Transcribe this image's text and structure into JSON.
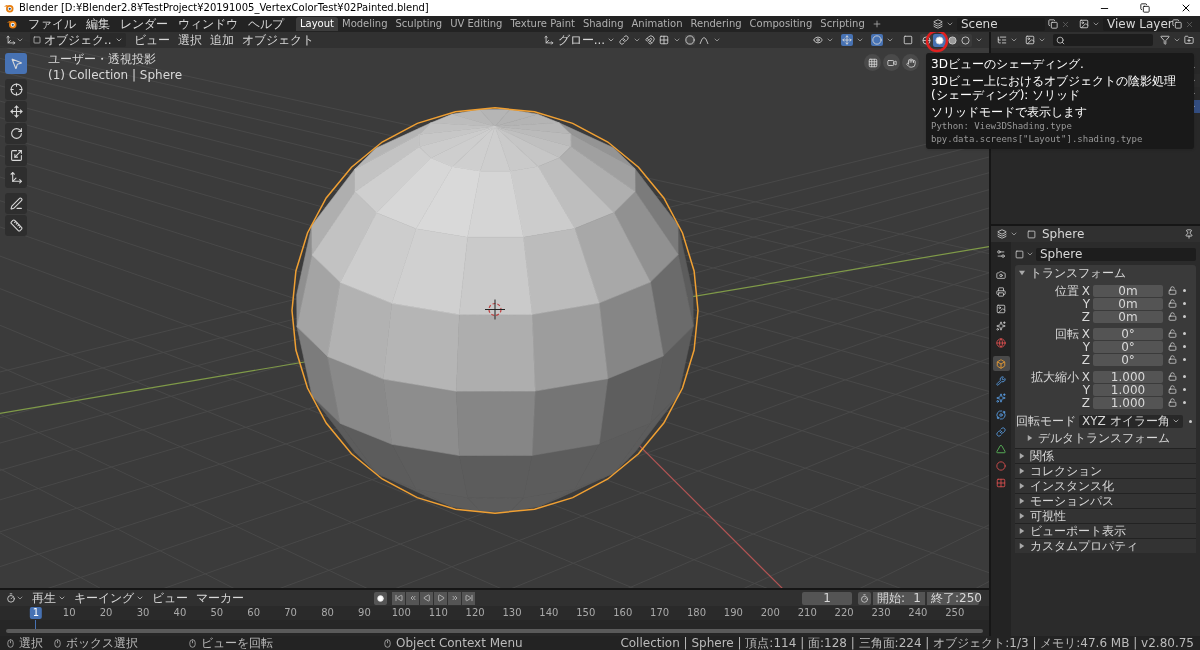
{
  "window": {
    "title": "Blender [D:¥Blender2.8¥TestProject¥20191005_VertexColorTest¥02Painted.blend]"
  },
  "menu": [
    "ファイル",
    "編集",
    "レンダー",
    "ウィンドウ",
    "ヘルプ"
  ],
  "workspaces": [
    {
      "label": "Layout",
      "selected": true
    },
    {
      "label": "Modeling",
      "selected": false
    },
    {
      "label": "Sculpting",
      "selected": false
    },
    {
      "label": "UV Editing",
      "selected": false
    },
    {
      "label": "Texture Paint",
      "selected": false
    },
    {
      "label": "Shading",
      "selected": false
    },
    {
      "label": "Animation",
      "selected": false
    },
    {
      "label": "Rendering",
      "selected": false
    },
    {
      "label": "Compositing",
      "selected": false
    },
    {
      "label": "Scripting",
      "selected": false
    }
  ],
  "scene": "Scene",
  "view_layer": "View Layer",
  "viewport": {
    "mode": "オブジェク..",
    "menus": [
      "ビュー",
      "選択",
      "追加",
      "オブジェクト"
    ],
    "orientation": "グロー...",
    "view_name": "ユーザー・透視投影",
    "collection_label": "(1) Collection | Sphere",
    "tools": [
      {
        "selected": true
      },
      {
        "selected": false
      },
      {
        "selected": false
      },
      {
        "selected": false
      },
      {
        "selected": false
      },
      {
        "selected": false
      },
      {
        "selected": false
      },
      {
        "selected": false
      }
    ],
    "shading_modes": [
      {
        "selected": false
      },
      {
        "selected": true
      },
      {
        "selected": false
      },
      {
        "selected": false
      }
    ]
  },
  "tooltip": {
    "title": "3Dビューのシェーディング.",
    "description": "3Dビュー上におけるオブジェクトの陰影処理(シェーディング): ソリッド",
    "detail": "ソリッドモードで表示します",
    "python": [
      "Python: View3DShading.type",
      "bpy.data.screens[\"Layout\"].shading.type"
    ]
  },
  "outliner": {
    "rows": [
      {
        "selected": false
      },
      {
        "selected": false
      },
      {
        "selected": false
      },
      {
        "selected": true
      }
    ]
  },
  "properties": {
    "object_name": "Sphere",
    "data_name": "Sphere",
    "tabs": [
      {
        "selected": false
      },
      {
        "selected": false
      },
      {
        "selected": false
      },
      {
        "selected": false
      },
      {
        "selected": false
      },
      {
        "selected": false
      },
      {
        "selected": true
      },
      {
        "selected": false
      },
      {
        "selected": false
      },
      {
        "selected": false
      },
      {
        "selected": false
      },
      {
        "selected": false
      },
      {
        "selected": false
      },
      {
        "selected": false
      }
    ],
    "transform": {
      "title": "トランスフォーム",
      "expanded": true,
      "groups": [
        {
          "label": "位置",
          "axes": [
            {
              "axis": "X",
              "value": "0m"
            },
            {
              "axis": "Y",
              "value": "0m"
            },
            {
              "axis": "Z",
              "value": "0m"
            }
          ]
        },
        {
          "label": "回転",
          "axes": [
            {
              "axis": "X",
              "value": "0°"
            },
            {
              "axis": "Y",
              "value": "0°"
            },
            {
              "axis": "Z",
              "value": "0°"
            }
          ]
        },
        {
          "label": "拡大縮小",
          "axes": [
            {
              "axis": "X",
              "value": "1.000"
            },
            {
              "axis": "Y",
              "value": "1.000"
            },
            {
              "axis": "Z",
              "value": "1.000"
            }
          ]
        }
      ],
      "rotation_mode_label": "回転モード",
      "rotation_mode": "XYZ オイラー角",
      "subpanels": [
        {
          "label": "デルタトランスフォーム",
          "expanded": false
        }
      ]
    },
    "panels": [
      {
        "label": "関係",
        "expanded": false
      },
      {
        "label": "コレクション",
        "expanded": false
      },
      {
        "label": "インスタンス化",
        "expanded": false
      },
      {
        "label": "モーションパス",
        "expanded": false
      },
      {
        "label": "可視性",
        "expanded": false
      },
      {
        "label": "ビューポート表示",
        "expanded": false
      },
      {
        "label": "カスタムプロパティ",
        "expanded": false
      }
    ]
  },
  "timeline": {
    "menus": [
      {
        "label": "再生",
        "dropdown": true
      },
      {
        "label": "キーイング",
        "dropdown": true
      },
      {
        "label": "ビュー",
        "dropdown": false
      },
      {
        "label": "マーカー",
        "dropdown": false
      }
    ],
    "current_frame": "1",
    "start_label": "開始:",
    "start": "1",
    "end_label": "終了:",
    "end": "250",
    "ticks": [
      {
        "label": "1",
        "selected": true
      },
      {
        "label": "10",
        "selected": false
      },
      {
        "label": "20",
        "selected": false
      },
      {
        "label": "30",
        "selected": false
      },
      {
        "label": "40",
        "selected": false
      },
      {
        "label": "50",
        "selected": false
      },
      {
        "label": "60",
        "selected": false
      },
      {
        "label": "70",
        "selected": false
      },
      {
        "label": "80",
        "selected": false
      },
      {
        "label": "90",
        "selected": false
      },
      {
        "label": "100",
        "selected": false
      },
      {
        "label": "110",
        "selected": false
      },
      {
        "label": "120",
        "selected": false
      },
      {
        "label": "130",
        "selected": false
      },
      {
        "label": "140",
        "selected": false
      },
      {
        "label": "150",
        "selected": false
      },
      {
        "label": "160",
        "selected": false
      },
      {
        "label": "170",
        "selected": false
      },
      {
        "label": "180",
        "selected": false
      },
      {
        "label": "190",
        "selected": false
      },
      {
        "label": "200",
        "selected": false
      },
      {
        "label": "210",
        "selected": false
      },
      {
        "label": "220",
        "selected": false
      },
      {
        "label": "230",
        "selected": false
      },
      {
        "label": "240",
        "selected": false
      },
      {
        "label": "250",
        "selected": false
      }
    ]
  },
  "status_bar": {
    "hints": [
      "選択",
      "ボックス選択",
      "ビューを回転",
      "Object Context Menu"
    ],
    "stats": "Collection | Sphere | 頂点:114 | 面:128 | 三角面:224 | オブジェクト:1/3 | メモリ:47.6 MB | v2.80.75"
  }
}
